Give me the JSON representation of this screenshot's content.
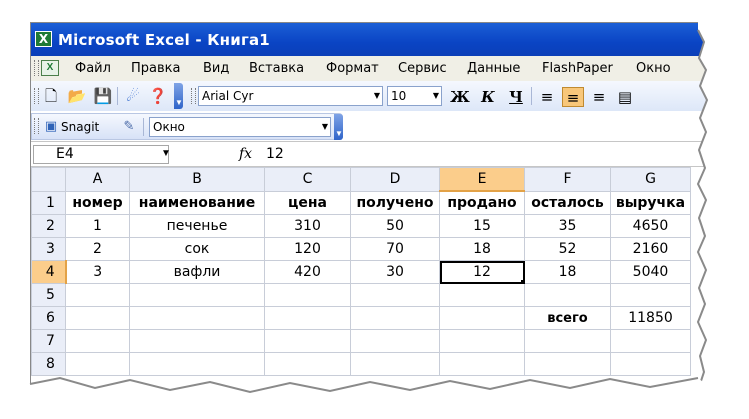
{
  "window": {
    "title": "Microsoft Excel - Книга1",
    "app_icon": "excel-icon"
  },
  "menu": {
    "items": [
      "Файл",
      "Правка",
      "Вид",
      "Вставка",
      "Формат",
      "Сервис",
      "Данные",
      "FlashPaper",
      "Окно"
    ]
  },
  "toolbar": {
    "font_name": "Arial Cyr",
    "font_size": "10",
    "bold": "Ж",
    "italic": "К",
    "underline": "Ч"
  },
  "snagit": {
    "label": "Snagit",
    "window_combo": "Окно"
  },
  "formula_bar": {
    "name_box": "E4",
    "fx": "fx",
    "value": "12"
  },
  "grid": {
    "columns": [
      "A",
      "B",
      "C",
      "D",
      "E",
      "F",
      "G"
    ],
    "rows": [
      "1",
      "2",
      "3",
      "4",
      "5",
      "6",
      "7",
      "8"
    ],
    "active_column": "E",
    "active_row": "4",
    "headers": [
      "номер",
      "наименование",
      "цена",
      "получено",
      "продано",
      "осталось",
      "выручка"
    ],
    "data": [
      [
        "1",
        "печенье",
        "310",
        "50",
        "15",
        "35",
        "4650"
      ],
      [
        "2",
        "сок",
        "120",
        "70",
        "18",
        "52",
        "2160"
      ],
      [
        "3",
        "вафли",
        "420",
        "30",
        "12",
        "18",
        "5040"
      ]
    ],
    "total_label": "всего",
    "total_value": "11850"
  }
}
